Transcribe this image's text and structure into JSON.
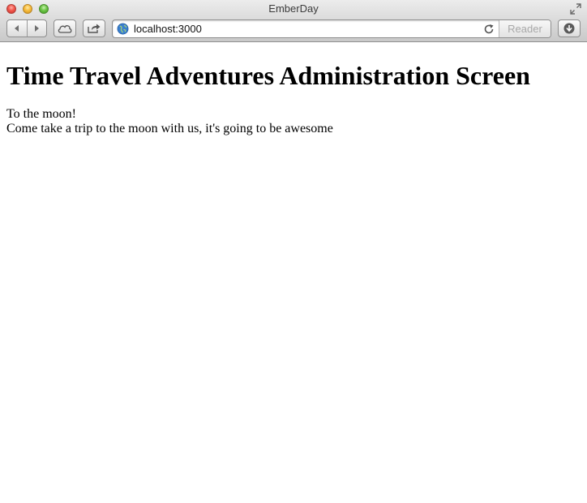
{
  "window": {
    "title": "EmberDay"
  },
  "toolbar": {
    "url": "localhost:3000",
    "reader_label": "Reader"
  },
  "page": {
    "heading": "Time Travel Adventures Administration Screen",
    "trip": {
      "name": "To the moon!",
      "description": "Come take a trip to the moon with us, it's going to be awesome"
    }
  }
}
